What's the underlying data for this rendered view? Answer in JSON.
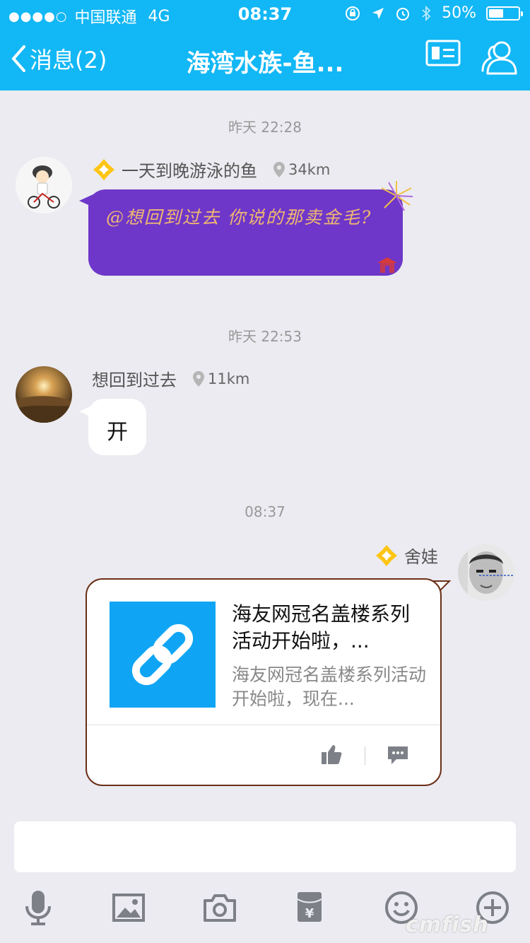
{
  "status_bar": {
    "signal_dots": "●●●●○",
    "carrier": "中国联通",
    "network": "4G",
    "time": "08:37",
    "battery_percent": "50%",
    "battery_level": 0.5
  },
  "nav": {
    "back_label": "消息(2)",
    "title": "海湾水族-鱼..."
  },
  "messages": [
    {
      "timestamp": "昨天 22:28",
      "sender": "一天到晚游泳的鱼",
      "distance": "34km",
      "text": "@想回到过去 你说的那卖金毛?"
    },
    {
      "timestamp": "昨天 22:53",
      "sender": "想回到过去",
      "distance": "11km",
      "text": "开"
    },
    {
      "timestamp": "08:37",
      "sender": "舍娃",
      "card_title": "海友网冠名盖楼系列活动开始啦，...",
      "card_desc": "海友网冠名盖楼系列活动开始啦，现在..."
    }
  ],
  "watermark": "cmfish",
  "colors": {
    "header_blue": "#12b7f5",
    "purple_bubble": "#6e37c9",
    "bubble_text": "#f1b870",
    "link_thumb": "#0fa5f4",
    "icon_gray": "#7d8087"
  },
  "icons": [
    "back-chevron",
    "profile-card-icon",
    "group-members-icon",
    "location-pin-icon",
    "badge-diamond-icon",
    "link-icon",
    "thumbs-up-icon",
    "comment-icon",
    "microphone-icon",
    "image-icon",
    "camera-icon",
    "red-packet-icon",
    "emoji-icon",
    "plus-circle-icon"
  ]
}
